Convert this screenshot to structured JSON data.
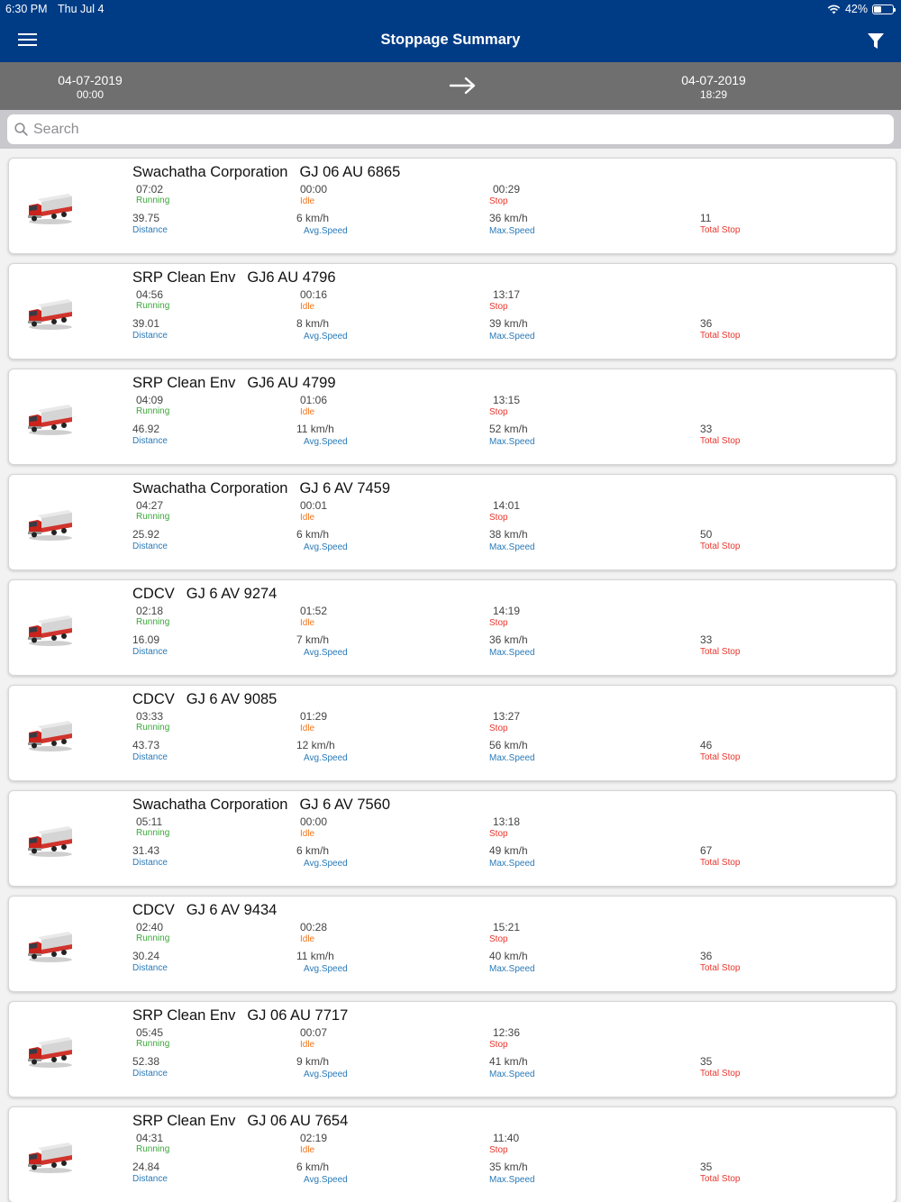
{
  "status_bar": {
    "time": "6:30 PM",
    "date": "Thu Jul 4",
    "battery": "42%"
  },
  "header": {
    "title": "Stoppage Summary"
  },
  "date_range": {
    "from_date": "04-07-2019",
    "from_time": "00:00",
    "to_date": "04-07-2019",
    "to_time": "18:29"
  },
  "search": {
    "placeholder": "Search"
  },
  "labels": {
    "running": "Running",
    "idle": "Idle",
    "stop": "Stop",
    "distance": "Distance",
    "avg_speed": "Avg.Speed",
    "max_speed": "Max.Speed",
    "total_stop": "Total Stop"
  },
  "vehicles": [
    {
      "company": "Swachatha Corporation",
      "plate": "GJ 06 AU 6865",
      "running": "07:02",
      "idle": "00:00",
      "stop": "00:29",
      "distance": "39.75",
      "avg_speed": "6 km/h",
      "max_speed": "36 km/h",
      "total_stop": "11"
    },
    {
      "company": "SRP Clean Env",
      "plate": "GJ6 AU 4796",
      "running": "04:56",
      "idle": "00:16",
      "stop": "13:17",
      "distance": "39.01",
      "avg_speed": "8 km/h",
      "max_speed": "39 km/h",
      "total_stop": "36"
    },
    {
      "company": "SRP Clean Env",
      "plate": "GJ6 AU 4799",
      "running": "04:09",
      "idle": "01:06",
      "stop": "13:15",
      "distance": "46.92",
      "avg_speed": "11 km/h",
      "max_speed": "52 km/h",
      "total_stop": "33"
    },
    {
      "company": "Swachatha Corporation",
      "plate": "GJ 6 AV 7459",
      "running": "04:27",
      "idle": "00:01",
      "stop": "14:01",
      "distance": "25.92",
      "avg_speed": "6 km/h",
      "max_speed": "38 km/h",
      "total_stop": "50"
    },
    {
      "company": "CDCV",
      "plate": "GJ 6 AV 9274",
      "running": "02:18",
      "idle": "01:52",
      "stop": "14:19",
      "distance": "16.09",
      "avg_speed": "7 km/h",
      "max_speed": "36 km/h",
      "total_stop": "33"
    },
    {
      "company": "CDCV",
      "plate": "GJ 6 AV 9085",
      "running": "03:33",
      "idle": "01:29",
      "stop": "13:27",
      "distance": "43.73",
      "avg_speed": "12 km/h",
      "max_speed": "56 km/h",
      "total_stop": "46"
    },
    {
      "company": "Swachatha Corporation",
      "plate": "GJ 6 AV 7560",
      "running": "05:11",
      "idle": "00:00",
      "stop": "13:18",
      "distance": "31.43",
      "avg_speed": "6 km/h",
      "max_speed": "49 km/h",
      "total_stop": "67"
    },
    {
      "company": "CDCV",
      "plate": "GJ 6 AV 9434",
      "running": "02:40",
      "idle": "00:28",
      "stop": "15:21",
      "distance": "30.24",
      "avg_speed": "11 km/h",
      "max_speed": "40 km/h",
      "total_stop": "36"
    },
    {
      "company": "SRP Clean Env",
      "plate": "GJ 06 AU 7717",
      "running": "05:45",
      "idle": "00:07",
      "stop": "12:36",
      "distance": "52.38",
      "avg_speed": "9 km/h",
      "max_speed": "41 km/h",
      "total_stop": "35"
    },
    {
      "company": "SRP Clean Env",
      "plate": "GJ 06 AU 7654",
      "running": "04:31",
      "idle": "02:19",
      "stop": "11:40",
      "distance": "24.84",
      "avg_speed": "6 km/h",
      "max_speed": "35 km/h",
      "total_stop": "35"
    }
  ],
  "colors": {
    "header": "#003c86",
    "date_bar": "#6f6f6f",
    "running": "#3aa63a",
    "idle": "#f0771f",
    "stop": "#e8362c",
    "label_blue": "#2a7ab8"
  },
  "icons": {
    "menu": "hamburger-icon",
    "filter": "filter-icon",
    "arrow": "arrow-right-icon",
    "search": "search-icon",
    "vehicle": "truck-icon",
    "wifi": "wifi-icon",
    "battery": "battery-icon"
  }
}
